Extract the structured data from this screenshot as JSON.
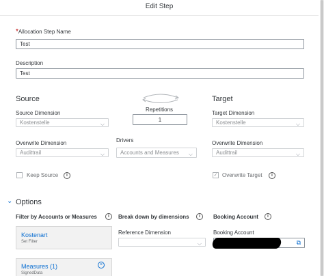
{
  "dialog": {
    "title": "Edit Step"
  },
  "step_name": {
    "required_mark": "*",
    "label": "Allocation Step Name",
    "value": "Test"
  },
  "description": {
    "label": "Description",
    "value": "Test"
  },
  "source": {
    "heading": "Source",
    "dimension_label": "Source Dimension",
    "dimension_value": "Kostenstelle",
    "overwrite_label": "Overwrite Dimension",
    "overwrite_value": "Audittrail",
    "keep_label": "Keep Source"
  },
  "repetitions": {
    "label": "Repetitions",
    "value": "1"
  },
  "drivers": {
    "label": "Drivers",
    "value": "Accounts and Measures"
  },
  "target": {
    "heading": "Target",
    "dimension_label": "Target Dimension",
    "dimension_value": "Kostenstelle",
    "overwrite_label": "Overwrite Dimension",
    "overwrite_value": "Audittrail",
    "overwrite_target_label": "Overwrite Target"
  },
  "options": {
    "heading": "Options",
    "filter_heading": "Filter by Accounts or Measures",
    "breakdown_heading": "Break down by dimensions",
    "booking_heading": "Booking Account",
    "kostenart_title": "Kostenart",
    "kostenart_sub": "Set Filter",
    "measures_title": "Measures (1)",
    "measures_sub": "SignedData",
    "reference_label": "Reference Dimension",
    "booking_label": "Booking Account"
  },
  "colors": {
    "accent": "#0a6ed1",
    "required": "#bb0000"
  },
  "icons": {
    "info": "info-icon",
    "chevron": "chevron-down-icon",
    "swap": "swap-arrows-icon",
    "remove": "remove-circle-icon",
    "value_help": "value-help-icon",
    "check": "check-icon"
  }
}
